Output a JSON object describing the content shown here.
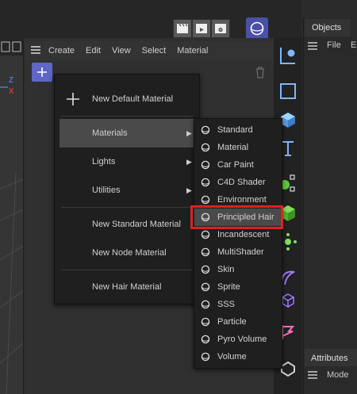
{
  "objects_panel": {
    "tab_label": "Objects",
    "menu": [
      "File",
      "Ed"
    ]
  },
  "attributes_panel": {
    "tab_label": "Attributes",
    "menu": [
      "Mode"
    ]
  },
  "material_manager": {
    "menu": [
      "Create",
      "Edit",
      "View",
      "Select",
      "Material"
    ]
  },
  "viewport": {
    "axis_z": "Z",
    "axis_x": "X"
  },
  "create_menu": {
    "items": [
      {
        "label": "New Default Material",
        "has_submenu": false,
        "icon": "plus-icon"
      },
      {
        "label": "Materials",
        "has_submenu": true,
        "highlighted": true
      },
      {
        "label": "Lights",
        "has_submenu": true
      },
      {
        "label": "Utilities",
        "has_submenu": true
      },
      {
        "label": "New Standard Material",
        "has_submenu": false
      },
      {
        "label": "New Node Material",
        "has_submenu": false
      },
      {
        "label": "New Hair Material",
        "has_submenu": false
      }
    ]
  },
  "materials_submenu": {
    "items": [
      "Standard",
      "Material",
      "Car Paint",
      "C4D Shader",
      "Environment",
      "Principled Hair",
      "Incandescent",
      "MultiShader",
      "Skin",
      "Sprite",
      "SSS",
      "Particle",
      "Pyro Volume",
      "Volume"
    ],
    "selected": "Principled Hair"
  },
  "colors": {
    "accent": "#5e66c8",
    "highlight_border": "#e02020",
    "menu_bg": "#1f1f1f",
    "menu_hover": "#4a4a4a"
  }
}
